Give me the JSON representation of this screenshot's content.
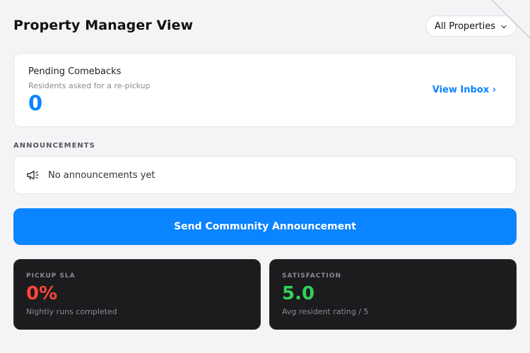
{
  "header": {
    "title": "Property Manager View",
    "property_filter": {
      "selected": "All Properties",
      "icon": "chevron-down-icon"
    }
  },
  "comebacks": {
    "title": "Pending Comebacks",
    "subtitle": "Residents asked for a re-pickup",
    "count": "0",
    "link_label": "View Inbox ›"
  },
  "announcements": {
    "section_label": "ANNOUNCEMENTS",
    "empty_text": "No announcements yet",
    "icon": "megaphone-icon"
  },
  "send_button": {
    "label": "Send Community Announcement"
  },
  "stats": [
    {
      "label": "PICKUP SLA",
      "value": "0%",
      "caption": "Nightly runs completed",
      "color": "#ff453a"
    },
    {
      "label": "SATISFACTION",
      "value": "5.0",
      "caption": "Avg resident rating / 5",
      "color": "#30d158"
    }
  ],
  "colors": {
    "accent": "#0a84ff",
    "background": "#f4f4f6",
    "stat_card_bg": "#1c1c1e"
  }
}
